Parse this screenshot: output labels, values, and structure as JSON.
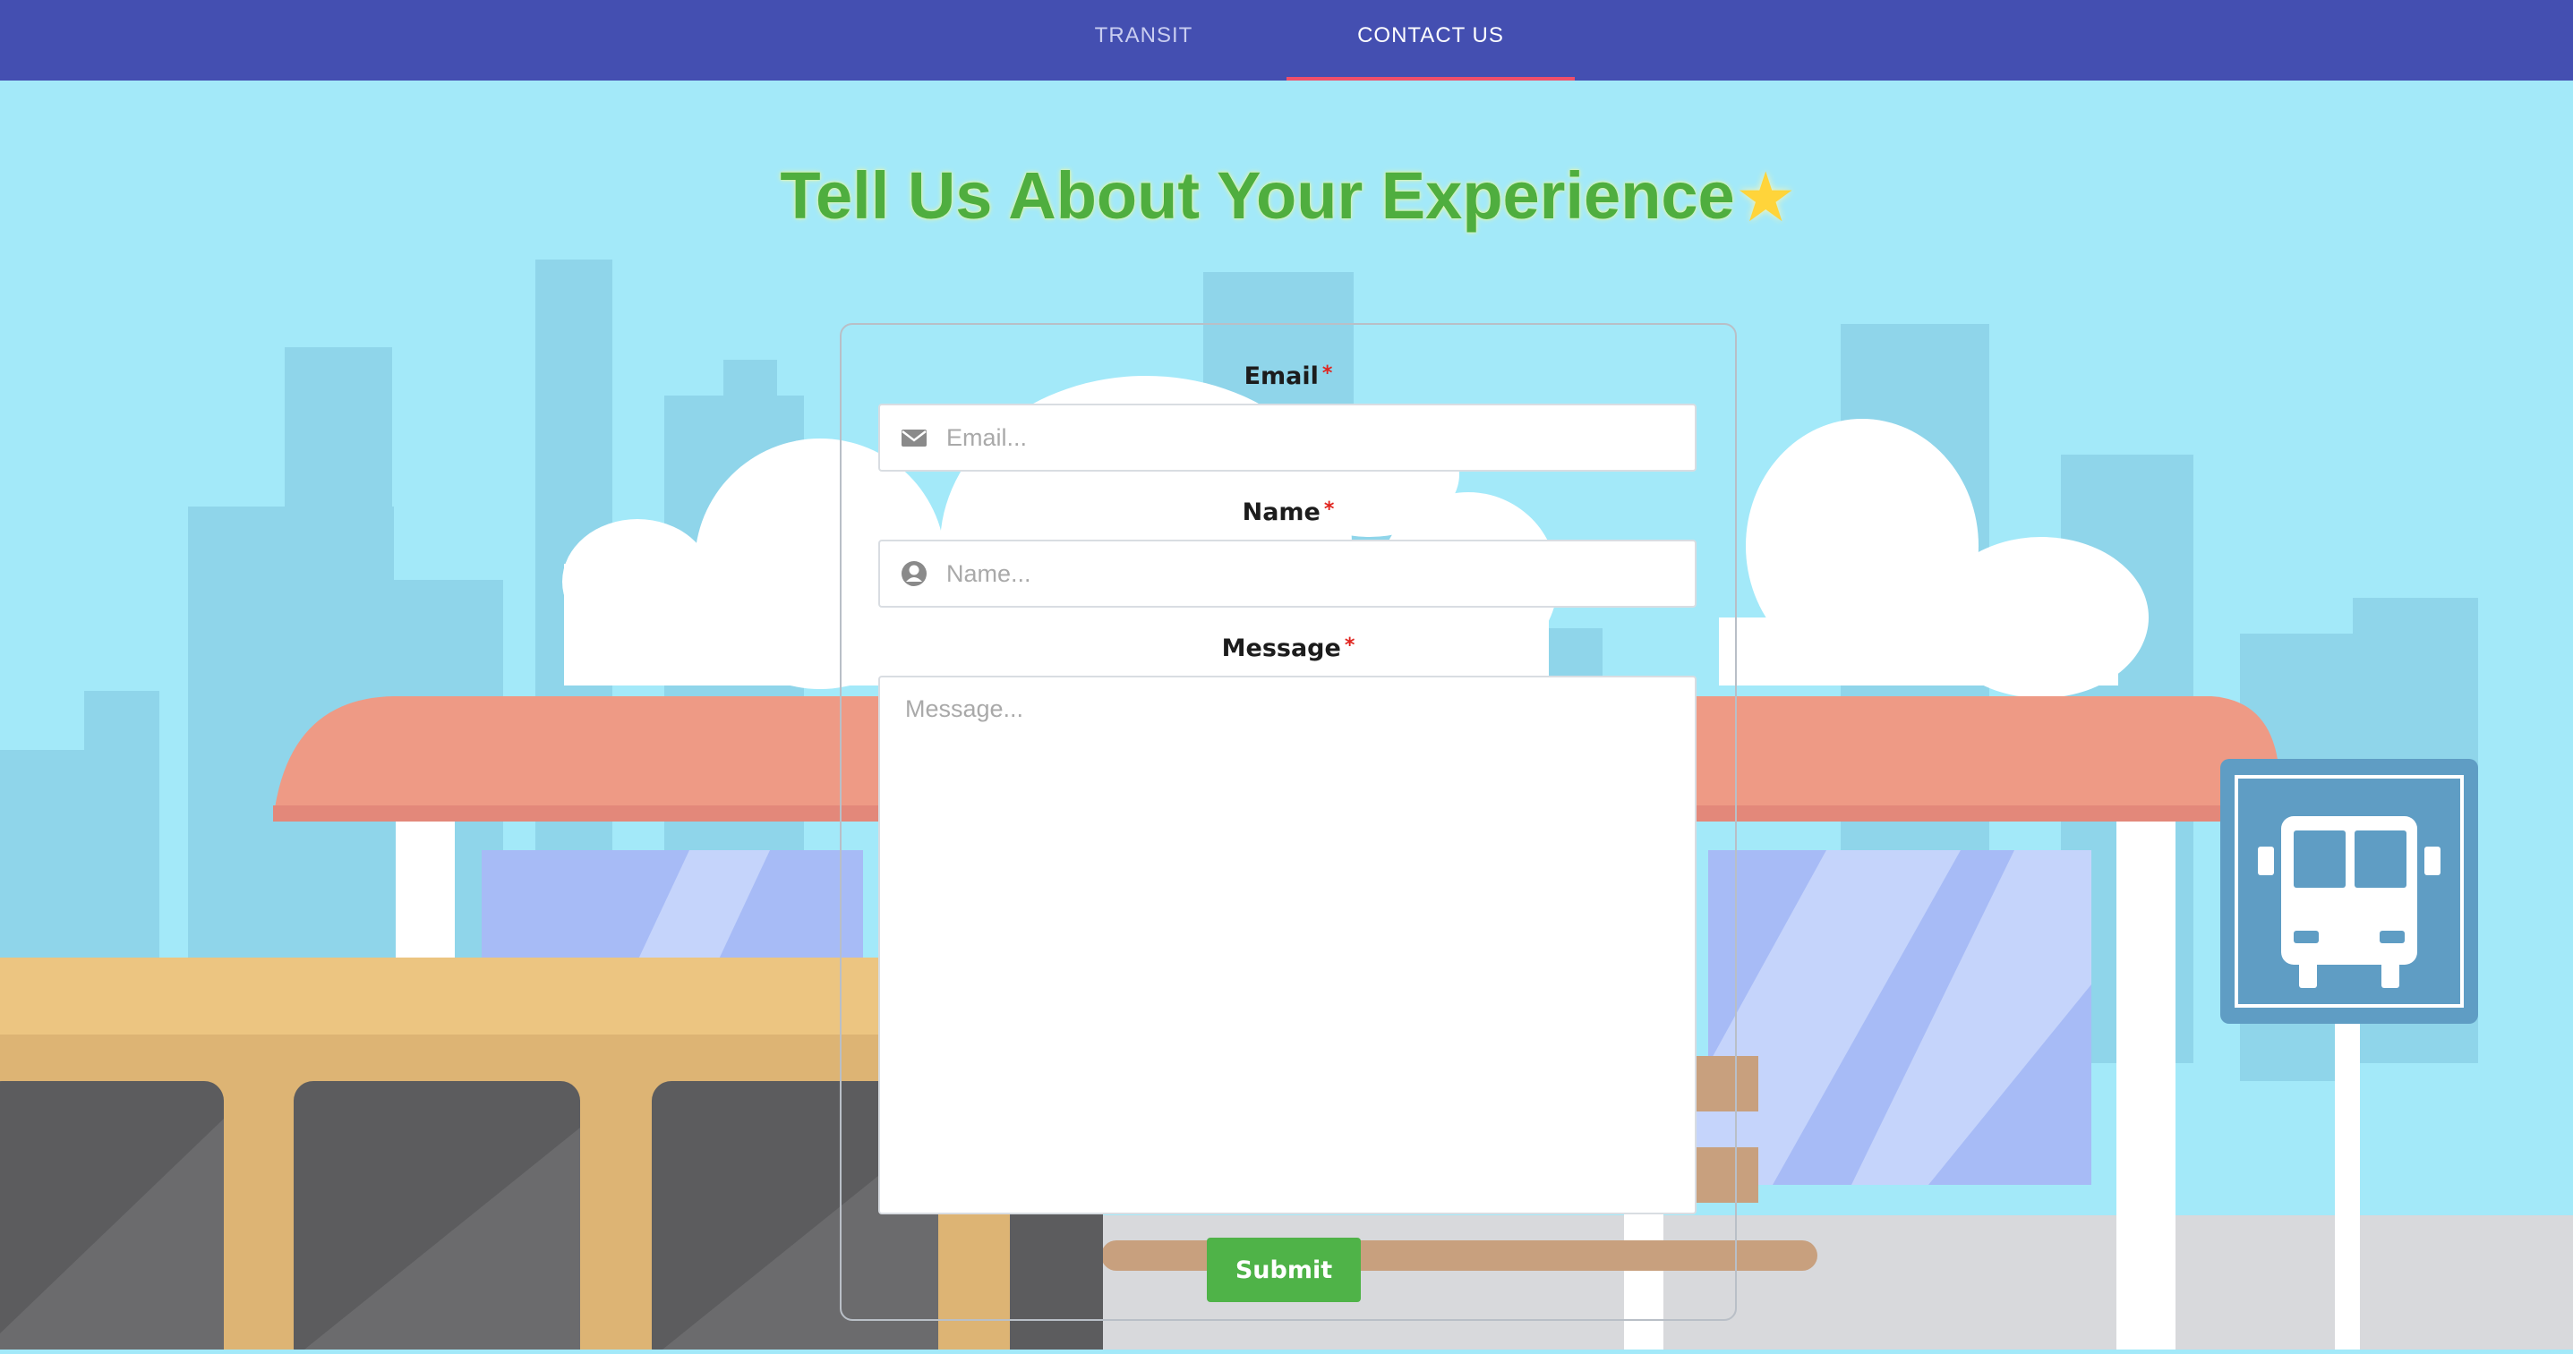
{
  "nav": {
    "tabs": [
      {
        "label": "TRANSIT",
        "active": false
      },
      {
        "label": "CONTACT US",
        "active": true
      }
    ],
    "background": "#444fb1",
    "indicator_color": "#f04f6a"
  },
  "page": {
    "title": "Tell Us About Your Experience",
    "title_icon": "star-icon"
  },
  "form": {
    "email": {
      "label": "Email",
      "required_mark": "*",
      "placeholder": "Email...",
      "icon": "envelope-icon"
    },
    "name": {
      "label": "Name",
      "required_mark": "*",
      "placeholder": "Name...",
      "icon": "user-circle-icon"
    },
    "message": {
      "label": "Message",
      "required_mark": "*",
      "placeholder": "Message..."
    },
    "submit_label": "Submit"
  },
  "background_scene": {
    "sign_icon": "bus-icon",
    "colors": {
      "sky": "#a3e9f9",
      "roof": "#ee9a85",
      "bus": "#ecc581",
      "submit": "#4fb348",
      "title": "#4fae3f"
    }
  }
}
